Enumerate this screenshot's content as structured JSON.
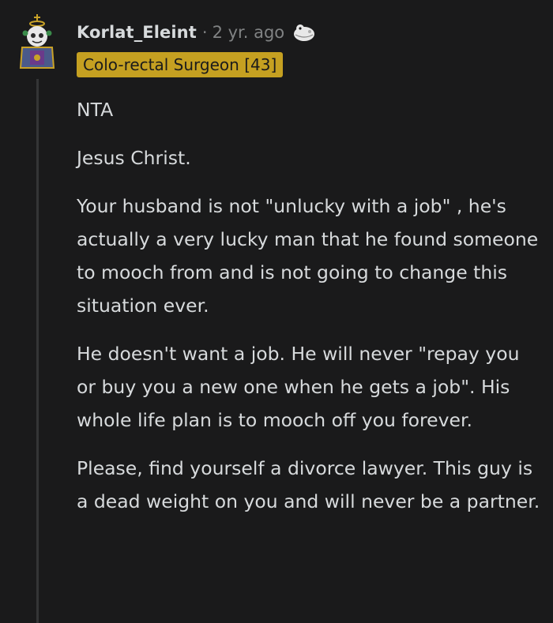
{
  "comment": {
    "username": "Korlat_Eleint",
    "separator": "·",
    "timestamp": "2 yr. ago",
    "flair": "Colo-rectal Surgeon [43]",
    "award_icon": "award-icon",
    "avatar_icon": "avatar-icon",
    "paragraphs": [
      "NTA",
      "Jesus Christ.",
      "Your husband is not \"unlucky with a job\" , he's actually a very lucky man that he found someone to mooch from and is not going to change this situation ever.",
      "He doesn't want a job. He will never \"repay you or buy you a new one when he gets a job\". His whole life plan is to mooch off you forever.",
      "Please, find yourself a divorce lawyer. This guy is a dead weight on you and will never be a partner."
    ]
  },
  "colors": {
    "background": "#1a1a1b",
    "text": "#d7dadc",
    "muted": "#818384",
    "flair_bg": "#c5a021",
    "thread_line": "#343536"
  }
}
